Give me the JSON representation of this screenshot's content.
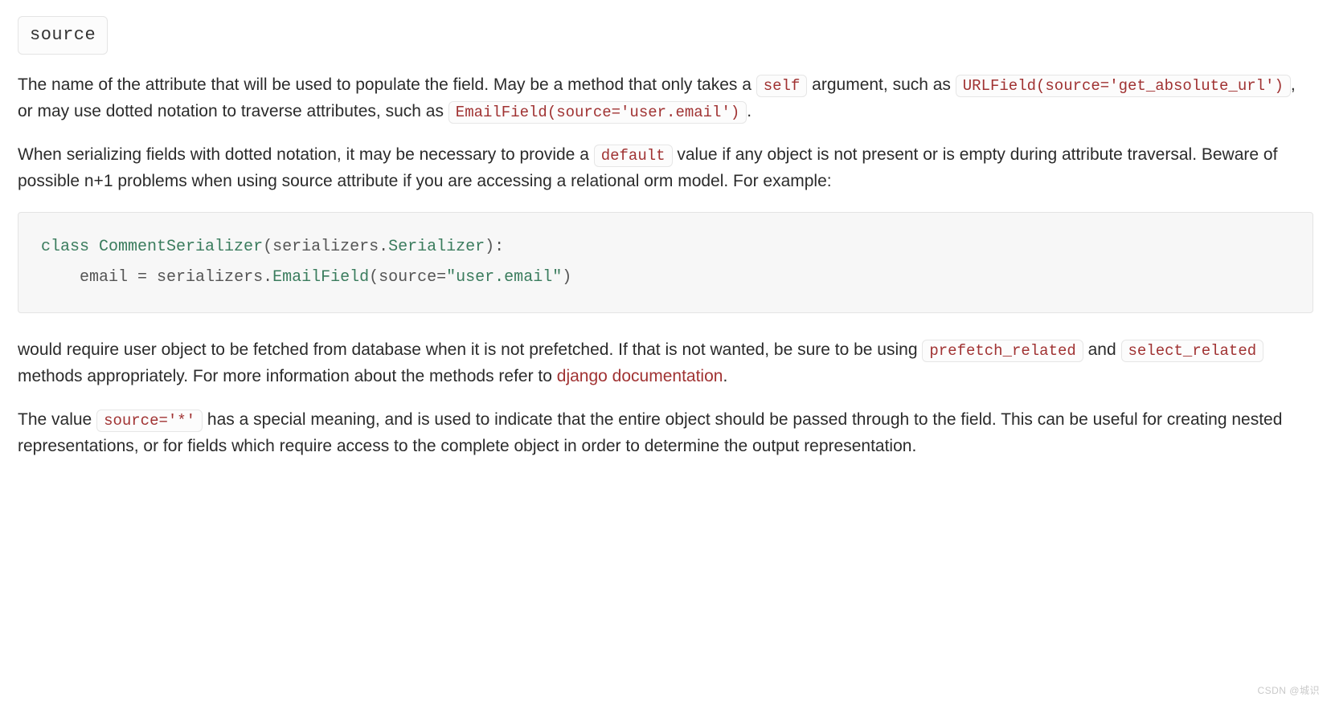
{
  "heading": "source",
  "para1": {
    "t1": "The name of the attribute that will be used to populate the field. May be a method that only takes a ",
    "code_self": "self",
    "t2": " argument, such as ",
    "code_urlfield": "URLField(source='get_absolute_url')",
    "t3": ", or may use dotted notation to traverse attributes, such as ",
    "code_emailfield": "EmailField(source='user.email')",
    "t4": "."
  },
  "para2": {
    "t1": "When serializing fields with dotted notation, it may be necessary to provide a ",
    "code_default": "default",
    "t2": " value if any object is not present or is empty during attribute traversal. Beware of possible n+1 problems when using source attribute if you are accessing a relational orm model. For example:"
  },
  "code": {
    "kw_class": "class",
    "cls_name": "CommentSerializer",
    "lparen1": "(",
    "base": "serializers",
    "dot1": ".",
    "base2": "Serializer",
    "rparen_colon": "):",
    "indent": "    ",
    "field": "email",
    "eq": " = ",
    "mod": "serializers",
    "dot2": ".",
    "ef": "EmailField",
    "lparen2": "(",
    "kwarg": "source",
    "eq2": "=",
    "str": "\"user.email\"",
    "rparen2": ")"
  },
  "para3": {
    "t1": "would require user object to be fetched from database when it is not prefetched. If that is not wanted, be sure to be using ",
    "code_prefetch": "prefetch_related",
    "t2": " and ",
    "code_select": "select_related",
    "t3": " methods appropriately. For more information about the methods refer to ",
    "link": "django documentation",
    "t4": "."
  },
  "para4": {
    "t1": "The value ",
    "code_star": "source='*'",
    "t2": " has a special meaning, and is used to indicate that the entire object should be passed through to the field. This can be useful for creating nested representations, or for fields which require access to the complete object in order to determine the output representation."
  },
  "watermark": "CSDN @城识"
}
